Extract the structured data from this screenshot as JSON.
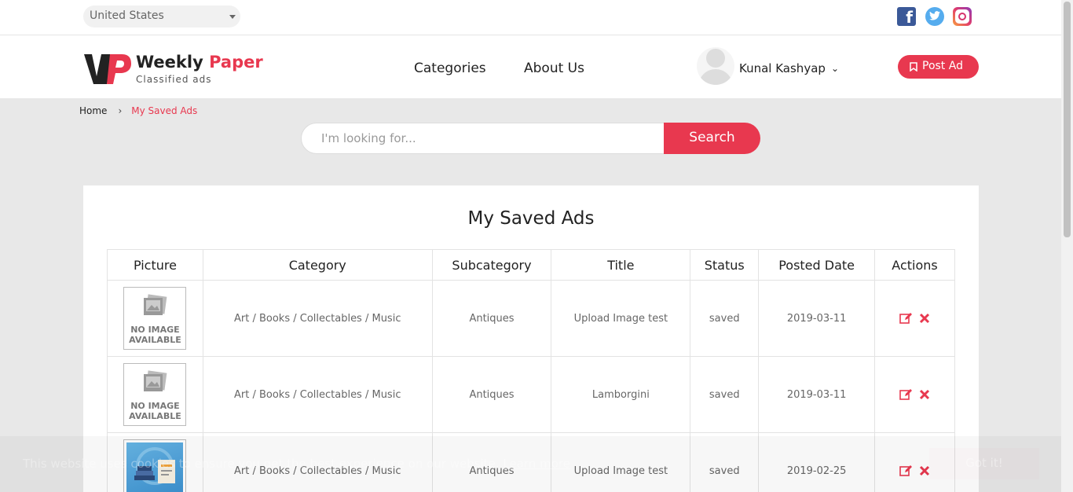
{
  "topbar": {
    "country": "United States",
    "social": [
      "facebook-icon",
      "twitter-icon",
      "instagram-icon"
    ]
  },
  "header": {
    "logo_name_part1": "Weekly",
    "logo_name_part2": "Paper",
    "logo_sub": "Classified ads",
    "nav": [
      "Categories",
      "About Us"
    ],
    "user_name": "Kunal Kashyap",
    "post_ad_label": "Post Ad"
  },
  "breadcrumb": {
    "home": "Home",
    "separator": "›",
    "current": "My Saved Ads"
  },
  "search": {
    "placeholder": "I'm looking for...",
    "button": "Search"
  },
  "main": {
    "title": "My Saved Ads",
    "columns": [
      "Picture",
      "Category",
      "Subcategory",
      "Title",
      "Status",
      "Posted Date",
      "Actions"
    ],
    "no_image_line1": "NO IMAGE",
    "no_image_line2": "AVAILABLE",
    "rows": [
      {
        "picture": "no-image",
        "category": "Art / Books / Collectables / Music",
        "subcategory": "Antiques",
        "title": "Upload Image test",
        "status": "saved",
        "posted_date": "2019-03-11"
      },
      {
        "picture": "no-image",
        "category": "Art / Books / Collectables / Music",
        "subcategory": "Antiques",
        "title": "Lamborgini",
        "status": "saved",
        "posted_date": "2019-03-11"
      },
      {
        "picture": "image",
        "category": "Art / Books / Collectables / Music",
        "subcategory": "Antiques",
        "title": "Upload Image test",
        "status": "saved",
        "posted_date": "2019-02-25"
      }
    ]
  },
  "cookie": {
    "text": "This website uses cookies to ensure you get the best experience on our website.",
    "learn_more": "Learn more",
    "button": "Got it!"
  },
  "colors": {
    "accent": "#e8384f",
    "background": "#e8e8e8"
  }
}
